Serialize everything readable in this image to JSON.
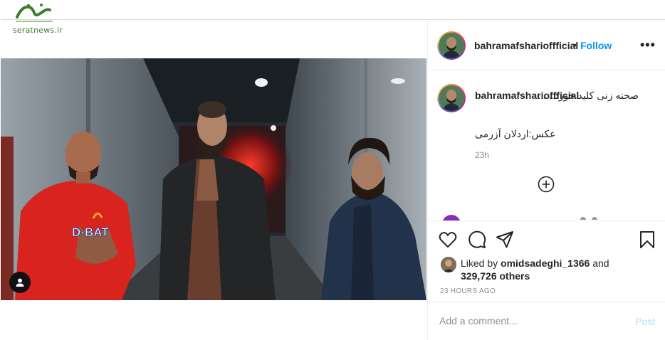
{
  "watermark": {
    "text": "seratnews.ir"
  },
  "post": {
    "username": "bahramafsharioffficial",
    "dot": "•",
    "follow_label": "Follow",
    "more_label": "•••",
    "caption": {
      "username": "bahramafsharioffficial",
      "text_line1": "صحنه زنی کلید خورد......",
      "text_line2": "عکس:اردلان آزرمی",
      "time": "23h"
    },
    "likes": {
      "prefix": "Liked by ",
      "user": "omidsadeghi_1366",
      "middle": " and",
      "count": "329,726 others"
    },
    "time_ago": "23 HOURS AGO",
    "comment": {
      "placeholder": "Add a comment...",
      "post_label": "Post"
    },
    "shirt_text": "D-BAT"
  },
  "colors": {
    "accent": "#0095f6",
    "post_disabled": "#b2dffc",
    "muted": "#8e8e8e"
  },
  "icons": [
    "heart-icon",
    "comment-icon",
    "share-icon",
    "bookmark-icon",
    "plus-circle-icon",
    "user-tag-icon",
    "more-icon"
  ]
}
